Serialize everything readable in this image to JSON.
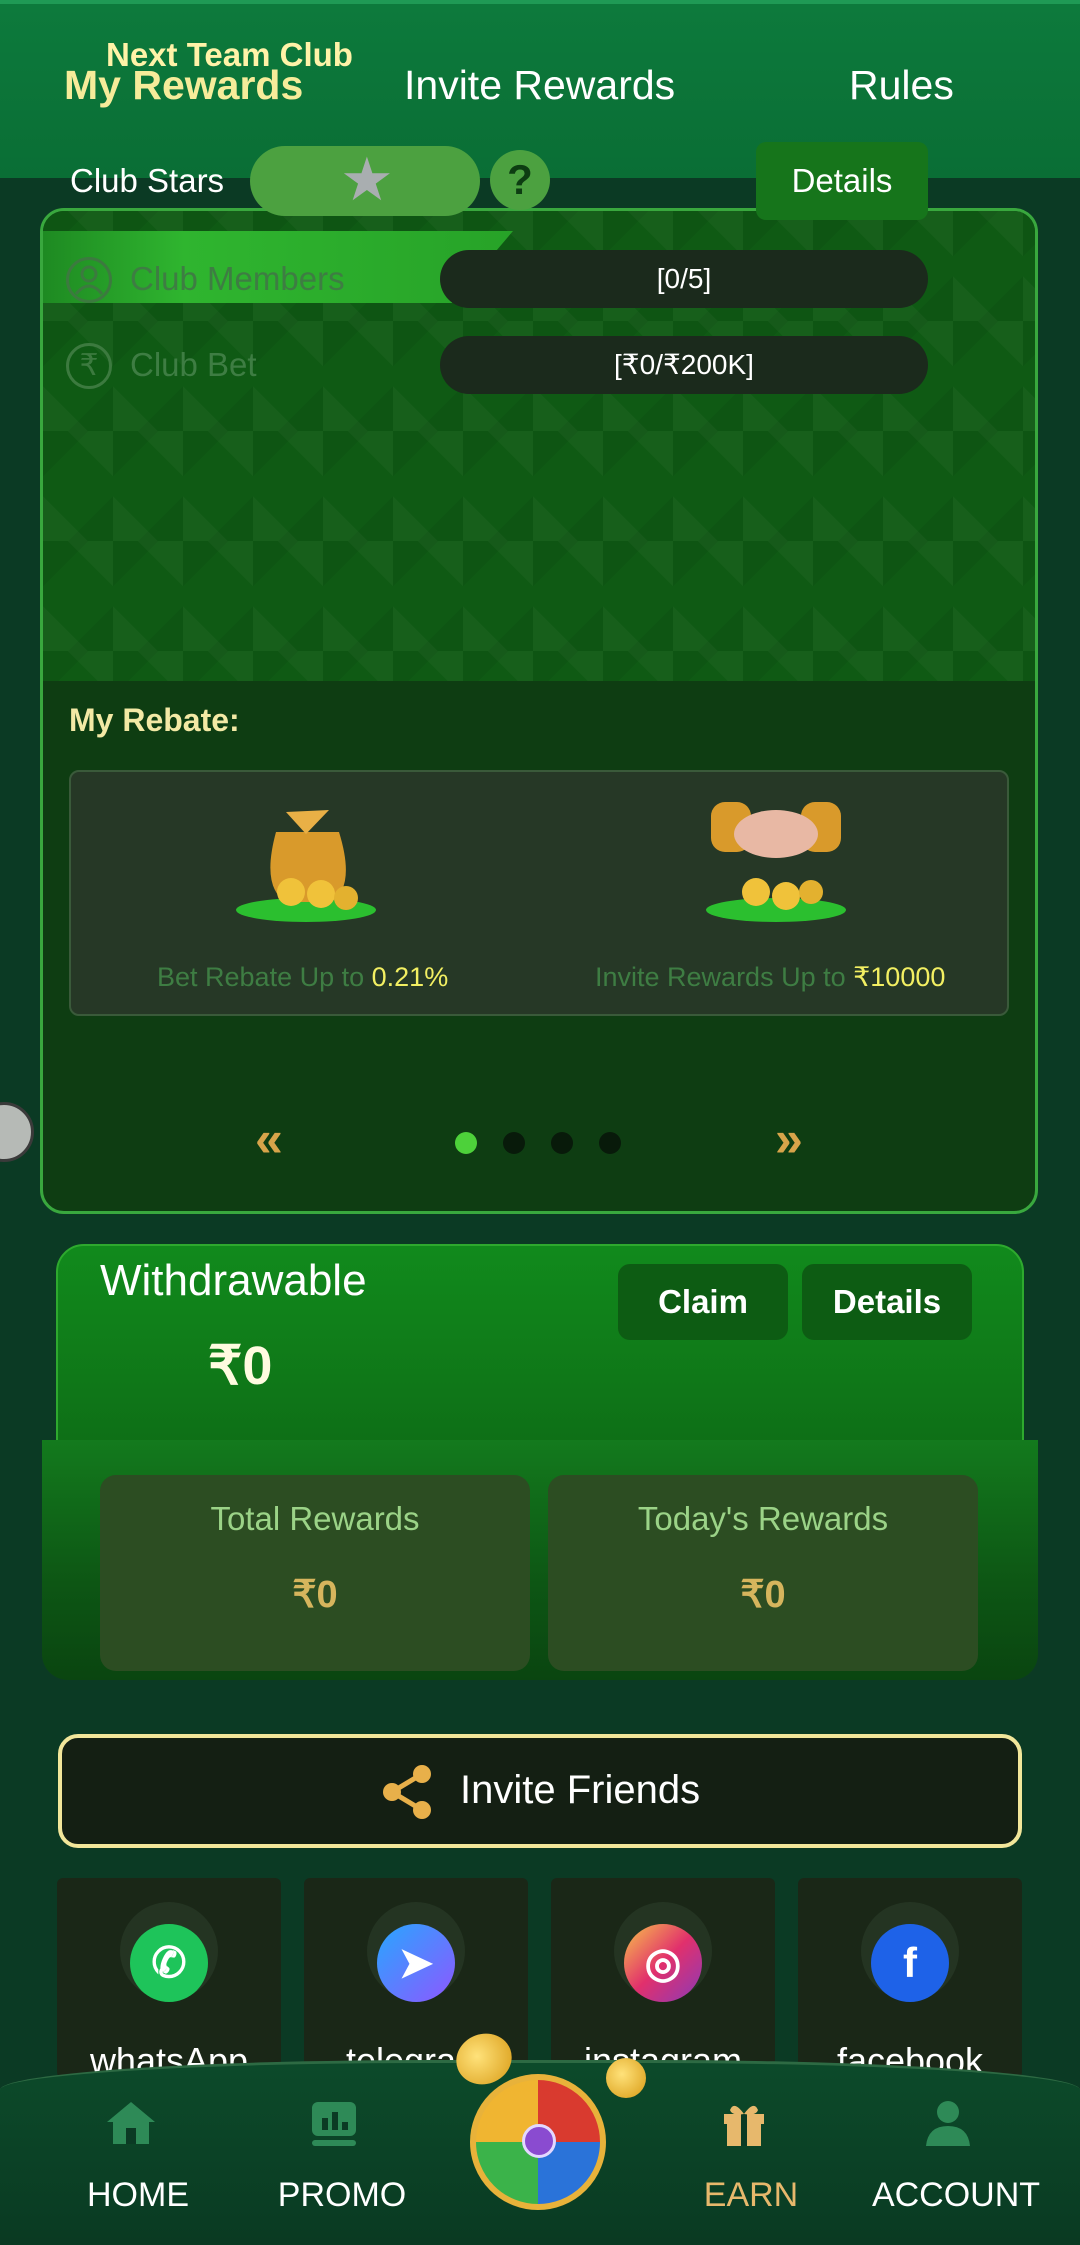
{
  "tabs": [
    {
      "label": "My Rewards",
      "active": true
    },
    {
      "label": "Invite Rewards",
      "active": false
    },
    {
      "label": "Rules",
      "active": false
    }
  ],
  "club": {
    "title": "Next Team Club",
    "stars_label": "Club Stars",
    "details_label": "Details",
    "members_label": "Club Members",
    "members_value": "[0/5]",
    "bet_label": "Club Bet",
    "bet_value": "[₹0/₹200K]"
  },
  "rebate": {
    "title": "My Rebate:",
    "items": [
      {
        "caption": "Bet Rebate Up to ",
        "highlight": "0.21%"
      },
      {
        "caption": "Invite Rewards Up to ",
        "highlight": "₹10000"
      }
    ],
    "pager": {
      "pages": 4,
      "current": 1
    }
  },
  "withdraw": {
    "label": "Withdrawable",
    "value": "₹0",
    "claim_label": "Claim",
    "details_label": "Details"
  },
  "rewards": {
    "total_label": "Total Rewards",
    "total_value": "₹0",
    "today_label": "Today's Rewards",
    "today_value": "₹0"
  },
  "invite": {
    "label": "Invite Friends"
  },
  "social": [
    {
      "label": "whatsApp",
      "icon": "whatsapp-icon"
    },
    {
      "label": "telegram",
      "icon": "telegram-icon"
    },
    {
      "label": "instagram",
      "icon": "instagram-icon"
    },
    {
      "label": "facebook",
      "icon": "facebook-icon"
    }
  ],
  "bottom_nav": [
    {
      "label": "HOME",
      "icon": "home-icon",
      "active": false
    },
    {
      "label": "PROMO",
      "icon": "promo-icon",
      "active": false
    },
    {
      "label": "EARN",
      "icon": "gift-icon",
      "active": true
    },
    {
      "label": "ACCOUNT",
      "icon": "account-icon",
      "active": false
    }
  ],
  "colors": {
    "accent_gold": "#f6ec9a",
    "brand_green": "#0d7a3c",
    "active_nav": "#e7b86c"
  }
}
